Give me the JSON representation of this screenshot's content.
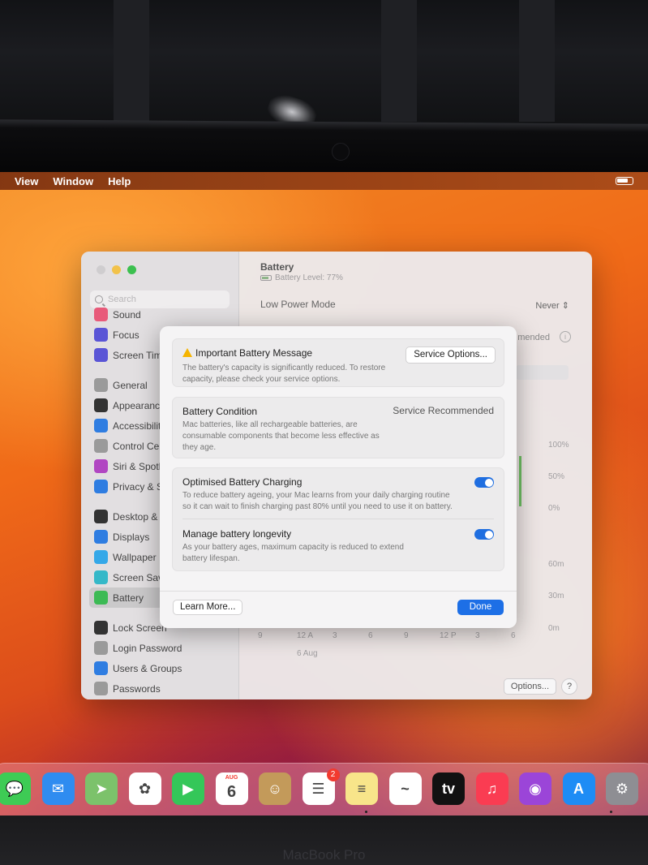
{
  "menubar": {
    "items": [
      "View",
      "Window",
      "Help"
    ]
  },
  "settings": {
    "search_placeholder": "Search",
    "sidebar": [
      {
        "label": "Sound",
        "icon": "sound-icon",
        "color": "#e85a7a"
      },
      {
        "label": "Focus",
        "icon": "moon-icon",
        "color": "#5a55d6"
      },
      {
        "label": "Screen Time",
        "icon": "hourglass-icon",
        "color": "#5a55d6"
      },
      {
        "label": "General",
        "icon": "gear-icon",
        "color": "#9a9a9a"
      },
      {
        "label": "Appearance",
        "icon": "appearance-icon",
        "color": "#333"
      },
      {
        "label": "Accessibility",
        "icon": "accessibility-icon",
        "color": "#2f7de1"
      },
      {
        "label": "Control Centre",
        "icon": "control-centre-icon",
        "color": "#9a9a9a"
      },
      {
        "label": "Siri & Spotlight",
        "icon": "siri-icon",
        "color": "#b146c2"
      },
      {
        "label": "Privacy & Security",
        "icon": "hand-icon",
        "color": "#2f7de1"
      },
      {
        "label": "Desktop & Dock",
        "icon": "dock-icon",
        "color": "#333"
      },
      {
        "label": "Displays",
        "icon": "sun-icon",
        "color": "#2f7de1"
      },
      {
        "label": "Wallpaper",
        "icon": "flower-icon",
        "color": "#35a8e8"
      },
      {
        "label": "Screen Saver",
        "icon": "screensaver-icon",
        "color": "#35b8c8"
      },
      {
        "label": "Battery",
        "icon": "battery-icon",
        "color": "#3cba54"
      },
      {
        "label": "Lock Screen",
        "icon": "lock-icon",
        "color": "#333"
      },
      {
        "label": "Login Password",
        "icon": "lock-icon",
        "color": "#9a9a9a"
      },
      {
        "label": "Users & Groups",
        "icon": "users-icon",
        "color": "#2f7de1"
      },
      {
        "label": "Passwords",
        "icon": "key-icon",
        "color": "#9a9a9a"
      }
    ],
    "content": {
      "title": "Battery",
      "level": "Battery Level: 77%",
      "low_power_label": "Low Power Mode",
      "low_power_value": "Never",
      "mended_text": "mended",
      "chart_y_labels": [
        "100%",
        "50%",
        "0%",
        "60m",
        "30m",
        "0m"
      ],
      "chart_x_labels": [
        "9",
        "12 A",
        "3",
        "6",
        "9",
        "12 P",
        "3",
        "6"
      ],
      "chart_date": "6 Aug",
      "options_label": "Options...",
      "help_label": "?"
    }
  },
  "sheet": {
    "message": {
      "title": "Important Battery Message",
      "desc": [
        "The battery's capacity is significantly reduced. To restore",
        "capacity, please check your service options."
      ],
      "button": "Service Options..."
    },
    "condition": {
      "title": "Battery Condition",
      "status": "Service Recommended",
      "desc": [
        "Mac batteries, like all rechargeable batteries, are",
        "consumable components that become less effective as",
        "they age."
      ]
    },
    "optimised": {
      "title": "Optimised Battery Charging",
      "desc": [
        "To reduce battery ageing, your Mac learns from your daily charging routine",
        "so it can wait to finish charging past 80% until you need to use it on battery."
      ],
      "enabled": true
    },
    "longevity": {
      "title": "Manage battery longevity",
      "desc": [
        "As your battery ages, maximum capacity is reduced to extend",
        "battery lifespan."
      ],
      "enabled": true
    },
    "learn_more": "Learn More...",
    "done": "Done"
  },
  "dock": {
    "apps": [
      {
        "name": "messages-icon",
        "color": "#3ecb55",
        "glyph": "💬"
      },
      {
        "name": "mail-icon",
        "color": "#2f8cf0",
        "glyph": "✉"
      },
      {
        "name": "maps-icon",
        "color": "#7cc26b",
        "glyph": "➤"
      },
      {
        "name": "photos-icon",
        "color": "#ffffff",
        "glyph": "✿"
      },
      {
        "name": "facetime-icon",
        "color": "#34c759",
        "glyph": "▶"
      },
      {
        "name": "calendar-icon",
        "color": "#ffffff",
        "glyph": "6"
      },
      {
        "name": "contacts-icon",
        "color": "#c39a5a",
        "glyph": "☺"
      },
      {
        "name": "reminders-icon",
        "color": "#ffffff",
        "glyph": "☰"
      },
      {
        "name": "notes-icon",
        "color": "#f8e58a",
        "glyph": "≡"
      },
      {
        "name": "freeform-icon",
        "color": "#ffffff",
        "glyph": "~"
      },
      {
        "name": "appletv-icon",
        "color": "#111111",
        "glyph": "tv"
      },
      {
        "name": "music-icon",
        "color": "#fa3c52",
        "glyph": "♫"
      },
      {
        "name": "podcasts-icon",
        "color": "#9b45d8",
        "glyph": "◉"
      },
      {
        "name": "appstore-icon",
        "color": "#1e8cf5",
        "glyph": "A"
      },
      {
        "name": "system-settings-icon",
        "color": "#8e8e93",
        "glyph": "⚙"
      }
    ],
    "calendar_month": "AUG",
    "reminders_badge": "2"
  },
  "device_label": "MacBook Pro"
}
